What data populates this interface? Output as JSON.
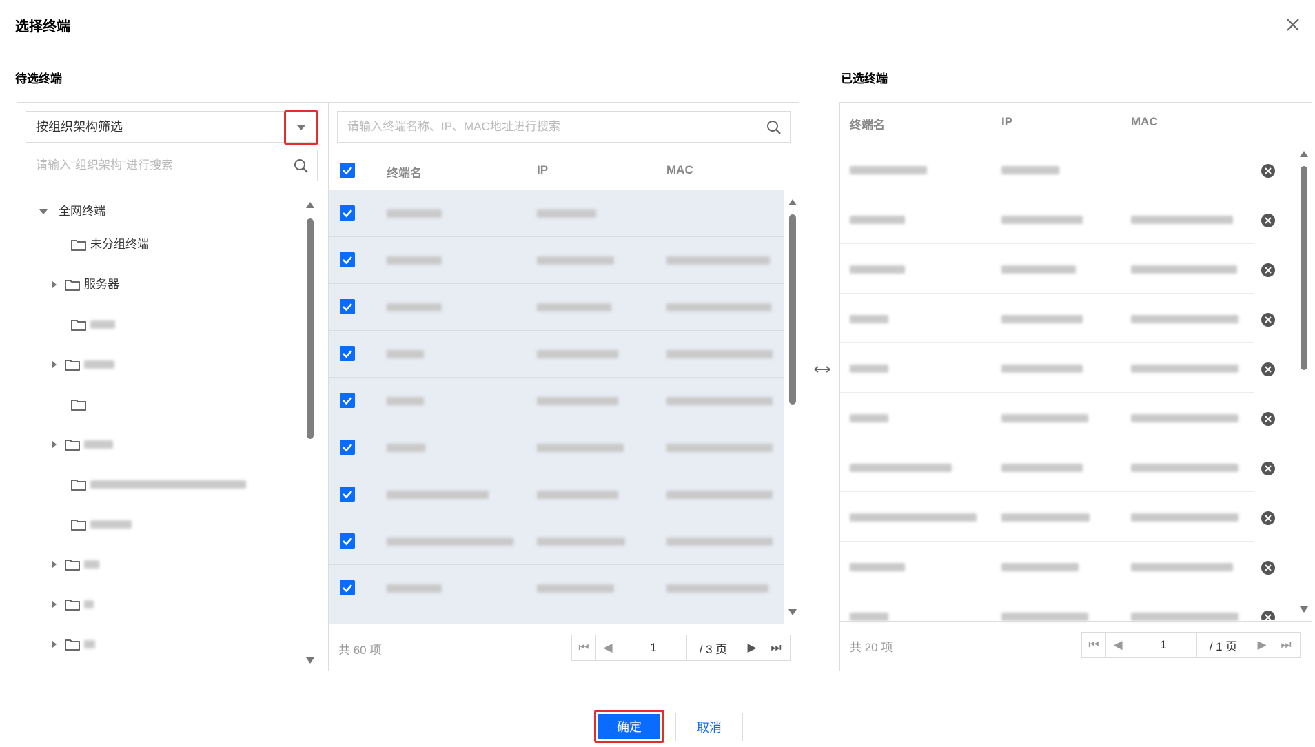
{
  "dialog": {
    "title": "选择终端"
  },
  "left": {
    "section_title": "待选终端",
    "filter_select": "按组织架构筛选",
    "org_search_placeholder": "请输入\"组织架构\"进行搜索",
    "tree": [
      {
        "label": "全网终端",
        "expanded": true
      },
      {
        "label": "未分组终端"
      },
      {
        "label": "服务器"
      }
    ],
    "list_search_placeholder": "请输入终端名称、IP、MAC地址进行搜索",
    "columns": {
      "name": "终端名",
      "ip": "IP",
      "mac": "MAC"
    },
    "total": "共 60 项",
    "pager": {
      "page": "1",
      "total_pages": "/ 3 页"
    }
  },
  "right": {
    "section_title": "已选终端",
    "columns": {
      "name": "终端名",
      "ip": "IP",
      "mac": "MAC"
    },
    "total": "共 20 项",
    "pager": {
      "page": "1",
      "total_pages": "/ 1 页"
    }
  },
  "footer": {
    "ok_label": "确定",
    "cancel_label": "取消"
  },
  "colors": {
    "primary": "#0a6cff",
    "highlight": "#e62c2c"
  }
}
